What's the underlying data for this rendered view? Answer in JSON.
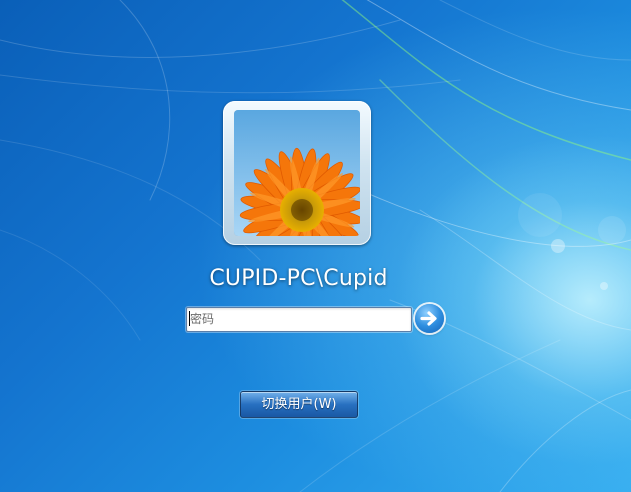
{
  "login": {
    "user_name": "CUPID-PC\\Cupid",
    "password_placeholder": "密码",
    "submit_icon": "arrow-right-icon",
    "switch_user_label": "切换用户(W)"
  },
  "wallpaper": {
    "theme": "windows-7-default"
  },
  "colors": {
    "background": "#1474cf",
    "flower_petal": "#f5760a",
    "flower_center": "#d9b400",
    "button_blue": "#2f8fe0"
  }
}
